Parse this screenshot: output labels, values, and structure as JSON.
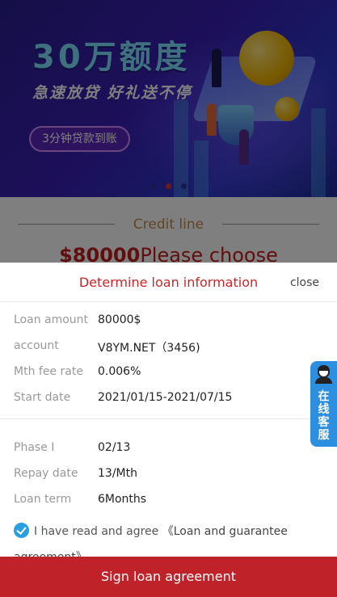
{
  "banner": {
    "title": "30万额度",
    "subtitle": "急速放贷  好礼送不停",
    "pill": "3分钟贷款到账",
    "accent": "#7fe0ff"
  },
  "credit": {
    "label": "Credit line",
    "amount": "$80000",
    "amount_suffix": "Please choose"
  },
  "sheet": {
    "title": "Determine loan information",
    "close_label": "close",
    "info": [
      {
        "key": "Loan amount",
        "value": "80000$"
      },
      {
        "key": "account",
        "value": "V8YM.NET（3456)"
      },
      {
        "key": "Mth fee rate",
        "value": "0.006%"
      },
      {
        "key": "Start date",
        "value": "2021/01/15-2021/07/15"
      }
    ],
    "plan": [
      {
        "key": "Phase I",
        "value": "02/13"
      },
      {
        "key": "Repay date",
        "value": "13/Mth"
      },
      {
        "key": "Loan term",
        "value": "6Months"
      }
    ],
    "agree_text": "I have read and agree",
    "agree_link": "《Loan and guarantee agreement》",
    "sign_label": "Sign loan agreement"
  },
  "service": {
    "label": "在线客服",
    "icon": "customer-service-icon"
  },
  "colors": {
    "primary": "#c0222a",
    "title_red": "#c8282b",
    "check_blue": "#2a9fe0",
    "service_blue": "#2d8fe0"
  }
}
